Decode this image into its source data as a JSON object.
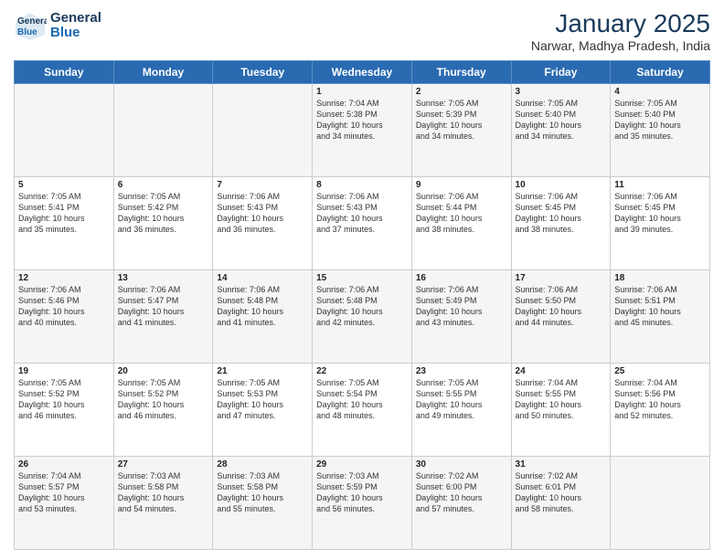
{
  "header": {
    "logo_general": "General",
    "logo_blue": "Blue",
    "main_title": "January 2025",
    "subtitle": "Narwar, Madhya Pradesh, India"
  },
  "weekdays": [
    "Sunday",
    "Monday",
    "Tuesday",
    "Wednesday",
    "Thursday",
    "Friday",
    "Saturday"
  ],
  "weeks": [
    [
      {
        "day": "",
        "info": ""
      },
      {
        "day": "",
        "info": ""
      },
      {
        "day": "",
        "info": ""
      },
      {
        "day": "1",
        "info": "Sunrise: 7:04 AM\nSunset: 5:38 PM\nDaylight: 10 hours\nand 34 minutes."
      },
      {
        "day": "2",
        "info": "Sunrise: 7:05 AM\nSunset: 5:39 PM\nDaylight: 10 hours\nand 34 minutes."
      },
      {
        "day": "3",
        "info": "Sunrise: 7:05 AM\nSunset: 5:40 PM\nDaylight: 10 hours\nand 34 minutes."
      },
      {
        "day": "4",
        "info": "Sunrise: 7:05 AM\nSunset: 5:40 PM\nDaylight: 10 hours\nand 35 minutes."
      }
    ],
    [
      {
        "day": "5",
        "info": "Sunrise: 7:05 AM\nSunset: 5:41 PM\nDaylight: 10 hours\nand 35 minutes."
      },
      {
        "day": "6",
        "info": "Sunrise: 7:05 AM\nSunset: 5:42 PM\nDaylight: 10 hours\nand 36 minutes."
      },
      {
        "day": "7",
        "info": "Sunrise: 7:06 AM\nSunset: 5:43 PM\nDaylight: 10 hours\nand 36 minutes."
      },
      {
        "day": "8",
        "info": "Sunrise: 7:06 AM\nSunset: 5:43 PM\nDaylight: 10 hours\nand 37 minutes."
      },
      {
        "day": "9",
        "info": "Sunrise: 7:06 AM\nSunset: 5:44 PM\nDaylight: 10 hours\nand 38 minutes."
      },
      {
        "day": "10",
        "info": "Sunrise: 7:06 AM\nSunset: 5:45 PM\nDaylight: 10 hours\nand 38 minutes."
      },
      {
        "day": "11",
        "info": "Sunrise: 7:06 AM\nSunset: 5:45 PM\nDaylight: 10 hours\nand 39 minutes."
      }
    ],
    [
      {
        "day": "12",
        "info": "Sunrise: 7:06 AM\nSunset: 5:46 PM\nDaylight: 10 hours\nand 40 minutes."
      },
      {
        "day": "13",
        "info": "Sunrise: 7:06 AM\nSunset: 5:47 PM\nDaylight: 10 hours\nand 41 minutes."
      },
      {
        "day": "14",
        "info": "Sunrise: 7:06 AM\nSunset: 5:48 PM\nDaylight: 10 hours\nand 41 minutes."
      },
      {
        "day": "15",
        "info": "Sunrise: 7:06 AM\nSunset: 5:48 PM\nDaylight: 10 hours\nand 42 minutes."
      },
      {
        "day": "16",
        "info": "Sunrise: 7:06 AM\nSunset: 5:49 PM\nDaylight: 10 hours\nand 43 minutes."
      },
      {
        "day": "17",
        "info": "Sunrise: 7:06 AM\nSunset: 5:50 PM\nDaylight: 10 hours\nand 44 minutes."
      },
      {
        "day": "18",
        "info": "Sunrise: 7:06 AM\nSunset: 5:51 PM\nDaylight: 10 hours\nand 45 minutes."
      }
    ],
    [
      {
        "day": "19",
        "info": "Sunrise: 7:05 AM\nSunset: 5:52 PM\nDaylight: 10 hours\nand 46 minutes."
      },
      {
        "day": "20",
        "info": "Sunrise: 7:05 AM\nSunset: 5:52 PM\nDaylight: 10 hours\nand 46 minutes."
      },
      {
        "day": "21",
        "info": "Sunrise: 7:05 AM\nSunset: 5:53 PM\nDaylight: 10 hours\nand 47 minutes."
      },
      {
        "day": "22",
        "info": "Sunrise: 7:05 AM\nSunset: 5:54 PM\nDaylight: 10 hours\nand 48 minutes."
      },
      {
        "day": "23",
        "info": "Sunrise: 7:05 AM\nSunset: 5:55 PM\nDaylight: 10 hours\nand 49 minutes."
      },
      {
        "day": "24",
        "info": "Sunrise: 7:04 AM\nSunset: 5:55 PM\nDaylight: 10 hours\nand 50 minutes."
      },
      {
        "day": "25",
        "info": "Sunrise: 7:04 AM\nSunset: 5:56 PM\nDaylight: 10 hours\nand 52 minutes."
      }
    ],
    [
      {
        "day": "26",
        "info": "Sunrise: 7:04 AM\nSunset: 5:57 PM\nDaylight: 10 hours\nand 53 minutes."
      },
      {
        "day": "27",
        "info": "Sunrise: 7:03 AM\nSunset: 5:58 PM\nDaylight: 10 hours\nand 54 minutes."
      },
      {
        "day": "28",
        "info": "Sunrise: 7:03 AM\nSunset: 5:58 PM\nDaylight: 10 hours\nand 55 minutes."
      },
      {
        "day": "29",
        "info": "Sunrise: 7:03 AM\nSunset: 5:59 PM\nDaylight: 10 hours\nand 56 minutes."
      },
      {
        "day": "30",
        "info": "Sunrise: 7:02 AM\nSunset: 6:00 PM\nDaylight: 10 hours\nand 57 minutes."
      },
      {
        "day": "31",
        "info": "Sunrise: 7:02 AM\nSunset: 6:01 PM\nDaylight: 10 hours\nand 58 minutes."
      },
      {
        "day": "",
        "info": ""
      }
    ]
  ]
}
